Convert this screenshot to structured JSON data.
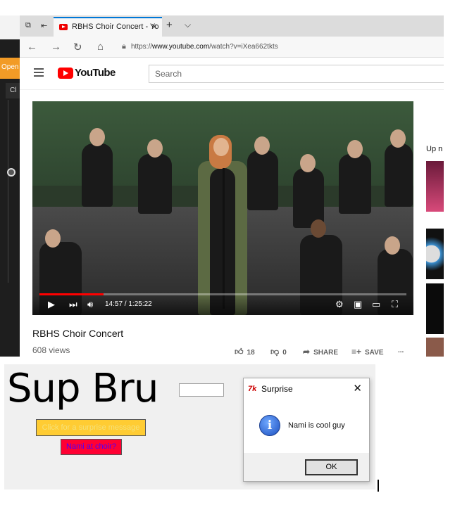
{
  "bg_window": {
    "orange_label": "Open",
    "tab_label": "Cl"
  },
  "browser": {
    "tab_title": "RBHS Choir Concert - Yo",
    "url_prefix": "https://",
    "url_domain": "www.youtube.com",
    "url_path": "/watch?v=iXea662tkts",
    "search_placeholder": "Search",
    "logo_text": "YouTube",
    "video": {
      "time": "14:57 / 1:25:22",
      "progress_fraction": 0.175
    },
    "video_title": "RBHS Choir Concert",
    "views": "608 views",
    "likes": "18",
    "dislikes": "0",
    "share_label": "SHARE",
    "save_label": "SAVE",
    "more_label": "...",
    "up_next_label": "Up n"
  },
  "tk_app": {
    "title": "Sup Bru",
    "entry_value": "",
    "surprise_button": "Click for a surprise message",
    "choir_button": "Nami at choir?"
  },
  "dialog": {
    "title": "Surprise",
    "icon_glyph": "7k",
    "message": "Nami is cool guy",
    "ok_label": "OK",
    "info_glyph": "i"
  }
}
